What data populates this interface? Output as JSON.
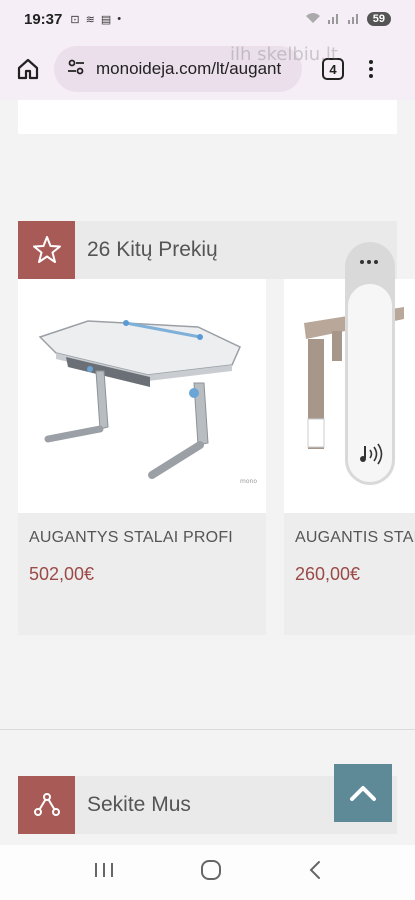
{
  "status": {
    "time": "19:37",
    "battery": "59"
  },
  "browser": {
    "url": "monoideja.com/lt/augant",
    "tab_count": "4",
    "watermark": "ilh skelbiu.lt"
  },
  "sections": {
    "other_products": {
      "title": "26 Kitų Prekių",
      "icon": "star-icon"
    },
    "follow": {
      "title": "Sekite Mus",
      "icon": "share-icon"
    }
  },
  "products": [
    {
      "name": "AUGANTYS STALAI PROFI",
      "price": "502,00€"
    },
    {
      "name": "AUGANTIS STALAS",
      "price": "260,00€"
    }
  ],
  "colors": {
    "accent": "#a85a57",
    "price": "#9a4a47",
    "scroll_top": "#5e8a98"
  }
}
